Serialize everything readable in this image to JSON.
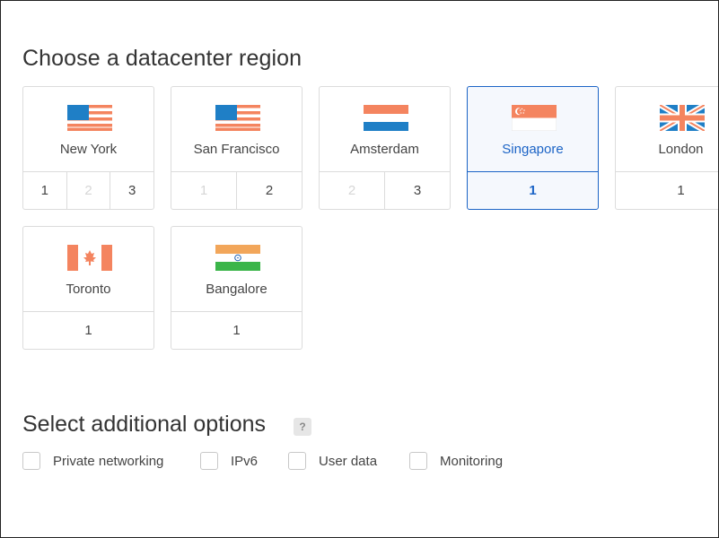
{
  "section1": {
    "title": "Choose a datacenter region"
  },
  "regions": [
    {
      "name": "New York",
      "flag": "us-flag",
      "slots": [
        "1",
        "2",
        "3"
      ]
    },
    {
      "name": "San Francisco",
      "flag": "us-flag",
      "slots": [
        "1",
        "2"
      ]
    },
    {
      "name": "Amsterdam",
      "flag": "nl-flag",
      "slots": [
        "2",
        "3"
      ]
    },
    {
      "name": "Singapore",
      "flag": "sg-flag",
      "slots": [
        "1"
      ],
      "selected": true
    },
    {
      "name": "London",
      "flag": "uk-flag",
      "slots": [
        "1"
      ]
    },
    {
      "name": "Toronto",
      "flag": "ca-flag",
      "slots": [
        "1"
      ]
    },
    {
      "name": "Bangalore",
      "flag": "in-flag",
      "slots": [
        "1"
      ]
    }
  ],
  "section2": {
    "title": "Select additional options",
    "help_icon": "?"
  },
  "options": [
    {
      "label": "Private networking",
      "checked": false
    },
    {
      "label": "IPv6",
      "checked": false
    },
    {
      "label": "User data",
      "checked": false
    },
    {
      "label": "Monitoring",
      "checked": false
    }
  ],
  "colors": {
    "accent": "#1c64c6",
    "flag_red": "#f4845f",
    "flag_blue": "#1f7fc6"
  }
}
